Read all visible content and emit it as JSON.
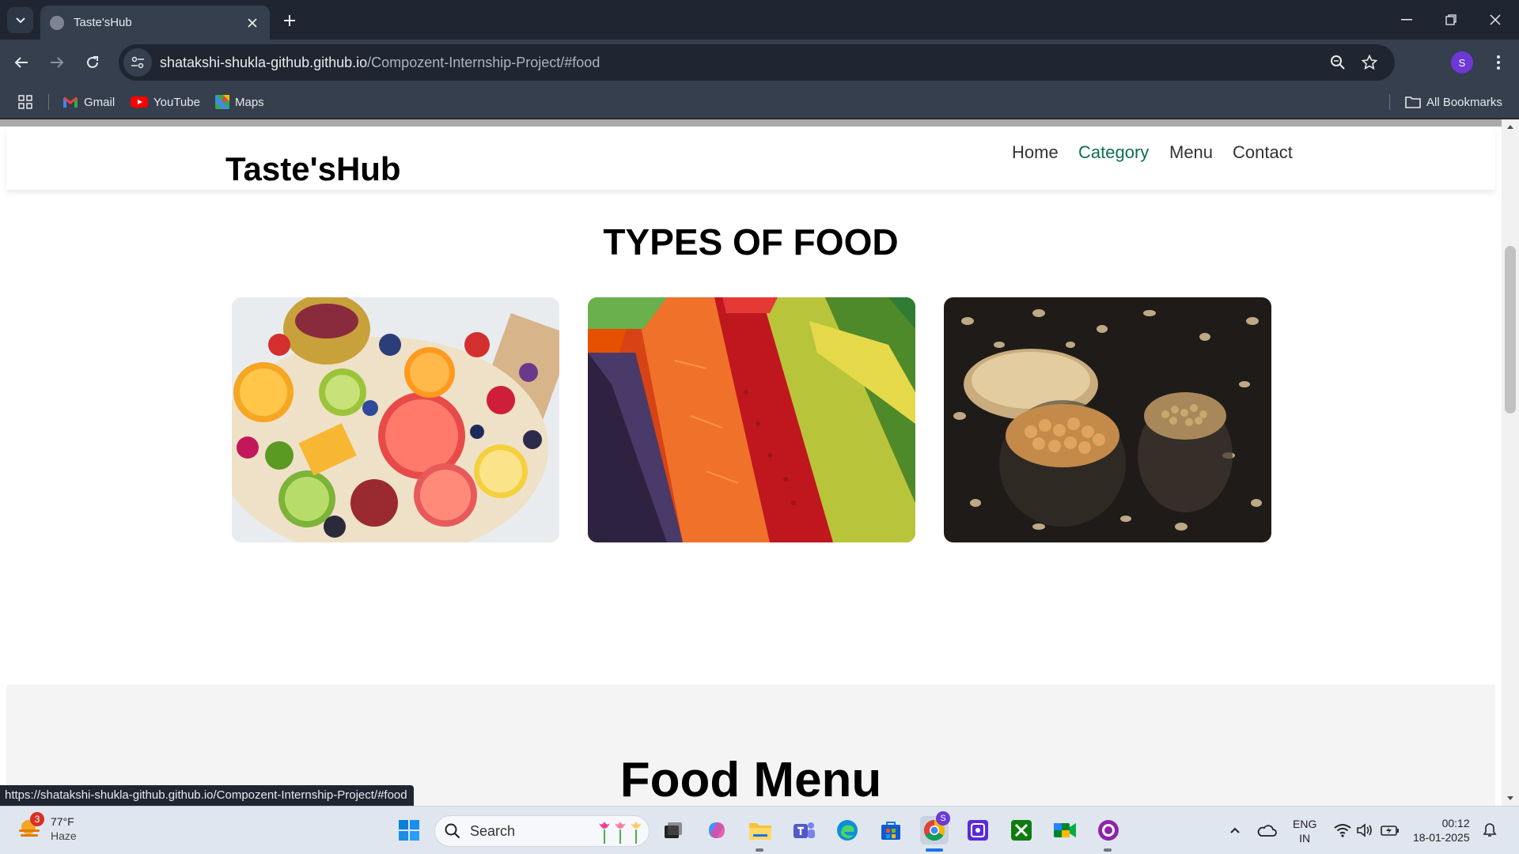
{
  "browser": {
    "tab_title": "Taste'sHub",
    "url_host": "shatakshi-shukla-github.github.io",
    "url_path": "/Compozent-Internship-Project/#food",
    "profile_initial": "S",
    "bookmarks": [
      "Gmail",
      "YouTube",
      "Maps"
    ],
    "all_bookmarks_label": "All Bookmarks",
    "status_url": "https://shatakshi-shukla-github.github.io/Compozent-Internship-Project/#food"
  },
  "site": {
    "logo": "Taste'sHub",
    "nav": [
      "Home",
      "Category",
      "Menu",
      "Contact"
    ],
    "active_nav": "Category",
    "accent_color": "#0d6e52",
    "food_section_title": "TYPES OF FOOD",
    "food_cards": [
      "fruits-image",
      "vegetables-image",
      "grains-image"
    ],
    "menu_section_title": "Food Menu"
  },
  "taskbar": {
    "weather_temp": "77°F",
    "weather_desc": "Haze",
    "weather_badge": "3",
    "search_label": "Search",
    "language": "ENG",
    "region": "IN",
    "time": "00:12",
    "date": "18-01-2025",
    "chrome_badge": "S"
  }
}
